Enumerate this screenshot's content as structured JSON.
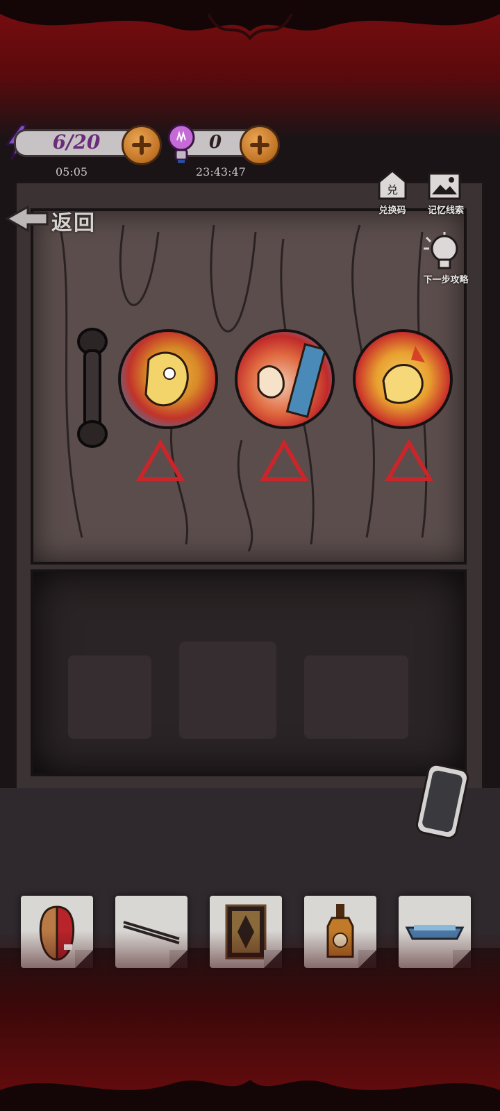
{
  "hud": {
    "energy": "6/20",
    "energy_timer": "05:05",
    "hints": "0",
    "hint_timer": "23:43:47"
  },
  "nav": {
    "back_label": "返回"
  },
  "side_buttons": {
    "redeem_label": "兑换码",
    "redeem_icon_text": "兑",
    "memory_label": "记忆线索",
    "guide_label": "下一步攻略"
  },
  "puzzle": {
    "slot_count": 3,
    "triangle_color": "#c8262a"
  },
  "inventory": {
    "items": [
      {
        "icon": "mask-icon"
      },
      {
        "icon": "chopsticks-icon"
      },
      {
        "icon": "rug-icon"
      },
      {
        "icon": "bottle-icon"
      },
      {
        "icon": "tray-icon"
      }
    ]
  },
  "colors": {
    "frame_red": "#7a0d10",
    "plus_orange": "#c07224",
    "energy_purple": "#6a2c7a"
  }
}
